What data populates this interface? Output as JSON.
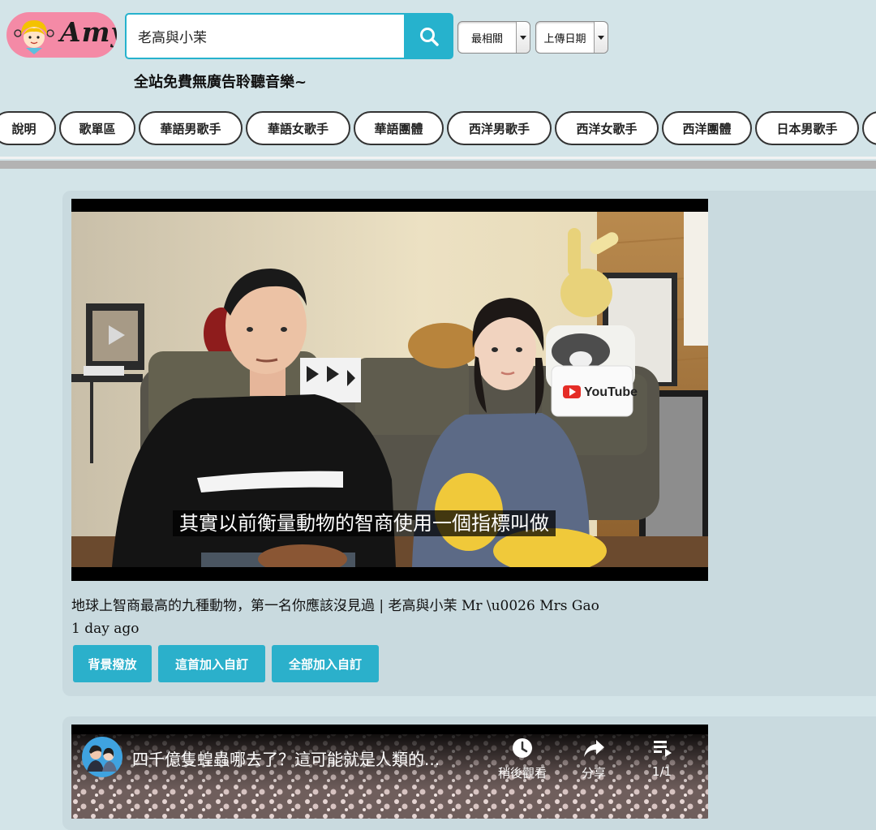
{
  "header": {
    "logo_text": "Amy",
    "search": {
      "value": "老高與小茉",
      "placeholder": ""
    },
    "sort_select": "最相關",
    "date_select": "上傳日期",
    "tagline": "全站免費無廣告聆聽音樂~"
  },
  "nav": {
    "items": [
      {
        "label": "說明"
      },
      {
        "label": "歌單區"
      },
      {
        "label": "華語男歌手"
      },
      {
        "label": "華語女歌手"
      },
      {
        "label": "華語團體"
      },
      {
        "label": "西洋男歌手"
      },
      {
        "label": "西洋女歌手"
      },
      {
        "label": "西洋團體"
      },
      {
        "label": "日本男歌手"
      }
    ]
  },
  "videos": [
    {
      "subtitle": "其實以前衡量動物的智商使用一個指標叫做",
      "youtube_pillow": "YouTube",
      "title": "地球上智商最高的九種動物，第一名你應該沒見過 | 老高與小茉 Mr \\u0026 Mrs Gao",
      "time": "1 day ago",
      "actions": {
        "background_play": "背景撥放",
        "add_this": "這首加入自訂",
        "add_all": "全部加入自訂"
      }
    },
    {
      "overlay_title": "四千億隻蝗蟲哪去了？這可能就是人類的...",
      "watch_later": "稍後觀看",
      "share": "分享",
      "playlist_count": "1/1"
    }
  ],
  "colors": {
    "page_bg": "#d3e4e8",
    "card_bg": "#c9dadf",
    "accent": "#26b2cd",
    "logo_bg": "#f48aa6"
  }
}
